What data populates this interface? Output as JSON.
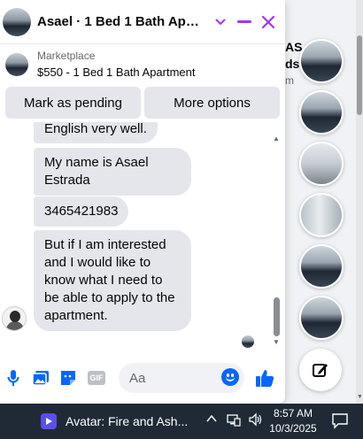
{
  "chat": {
    "title": "Asael · 1 Bed 1 Bath Apart...",
    "listing": {
      "category": "Marketplace",
      "name": "$550 - 1 Bed 1 Bath Apartment"
    },
    "actions": {
      "mark_pending": "Mark as pending",
      "more_options": "More options"
    },
    "messages": [
      "English very well.",
      "My name is Asael Estrada",
      "3465421983",
      "But if I am interested and I would like to know what I need to be able to apply to the apartment."
    ],
    "composer": {
      "placeholder": "Aa"
    },
    "colors": {
      "accent": "#0866ff",
      "header_icons": "#a033ff"
    }
  },
  "background": {
    "text_line1": "AS ",
    "text_line2": "ds",
    "text_line3": "m"
  },
  "taskbar": {
    "app_label": "Avatar: Fire and Ash...",
    "time": "8:57 AM",
    "date": "10/3/2025"
  }
}
